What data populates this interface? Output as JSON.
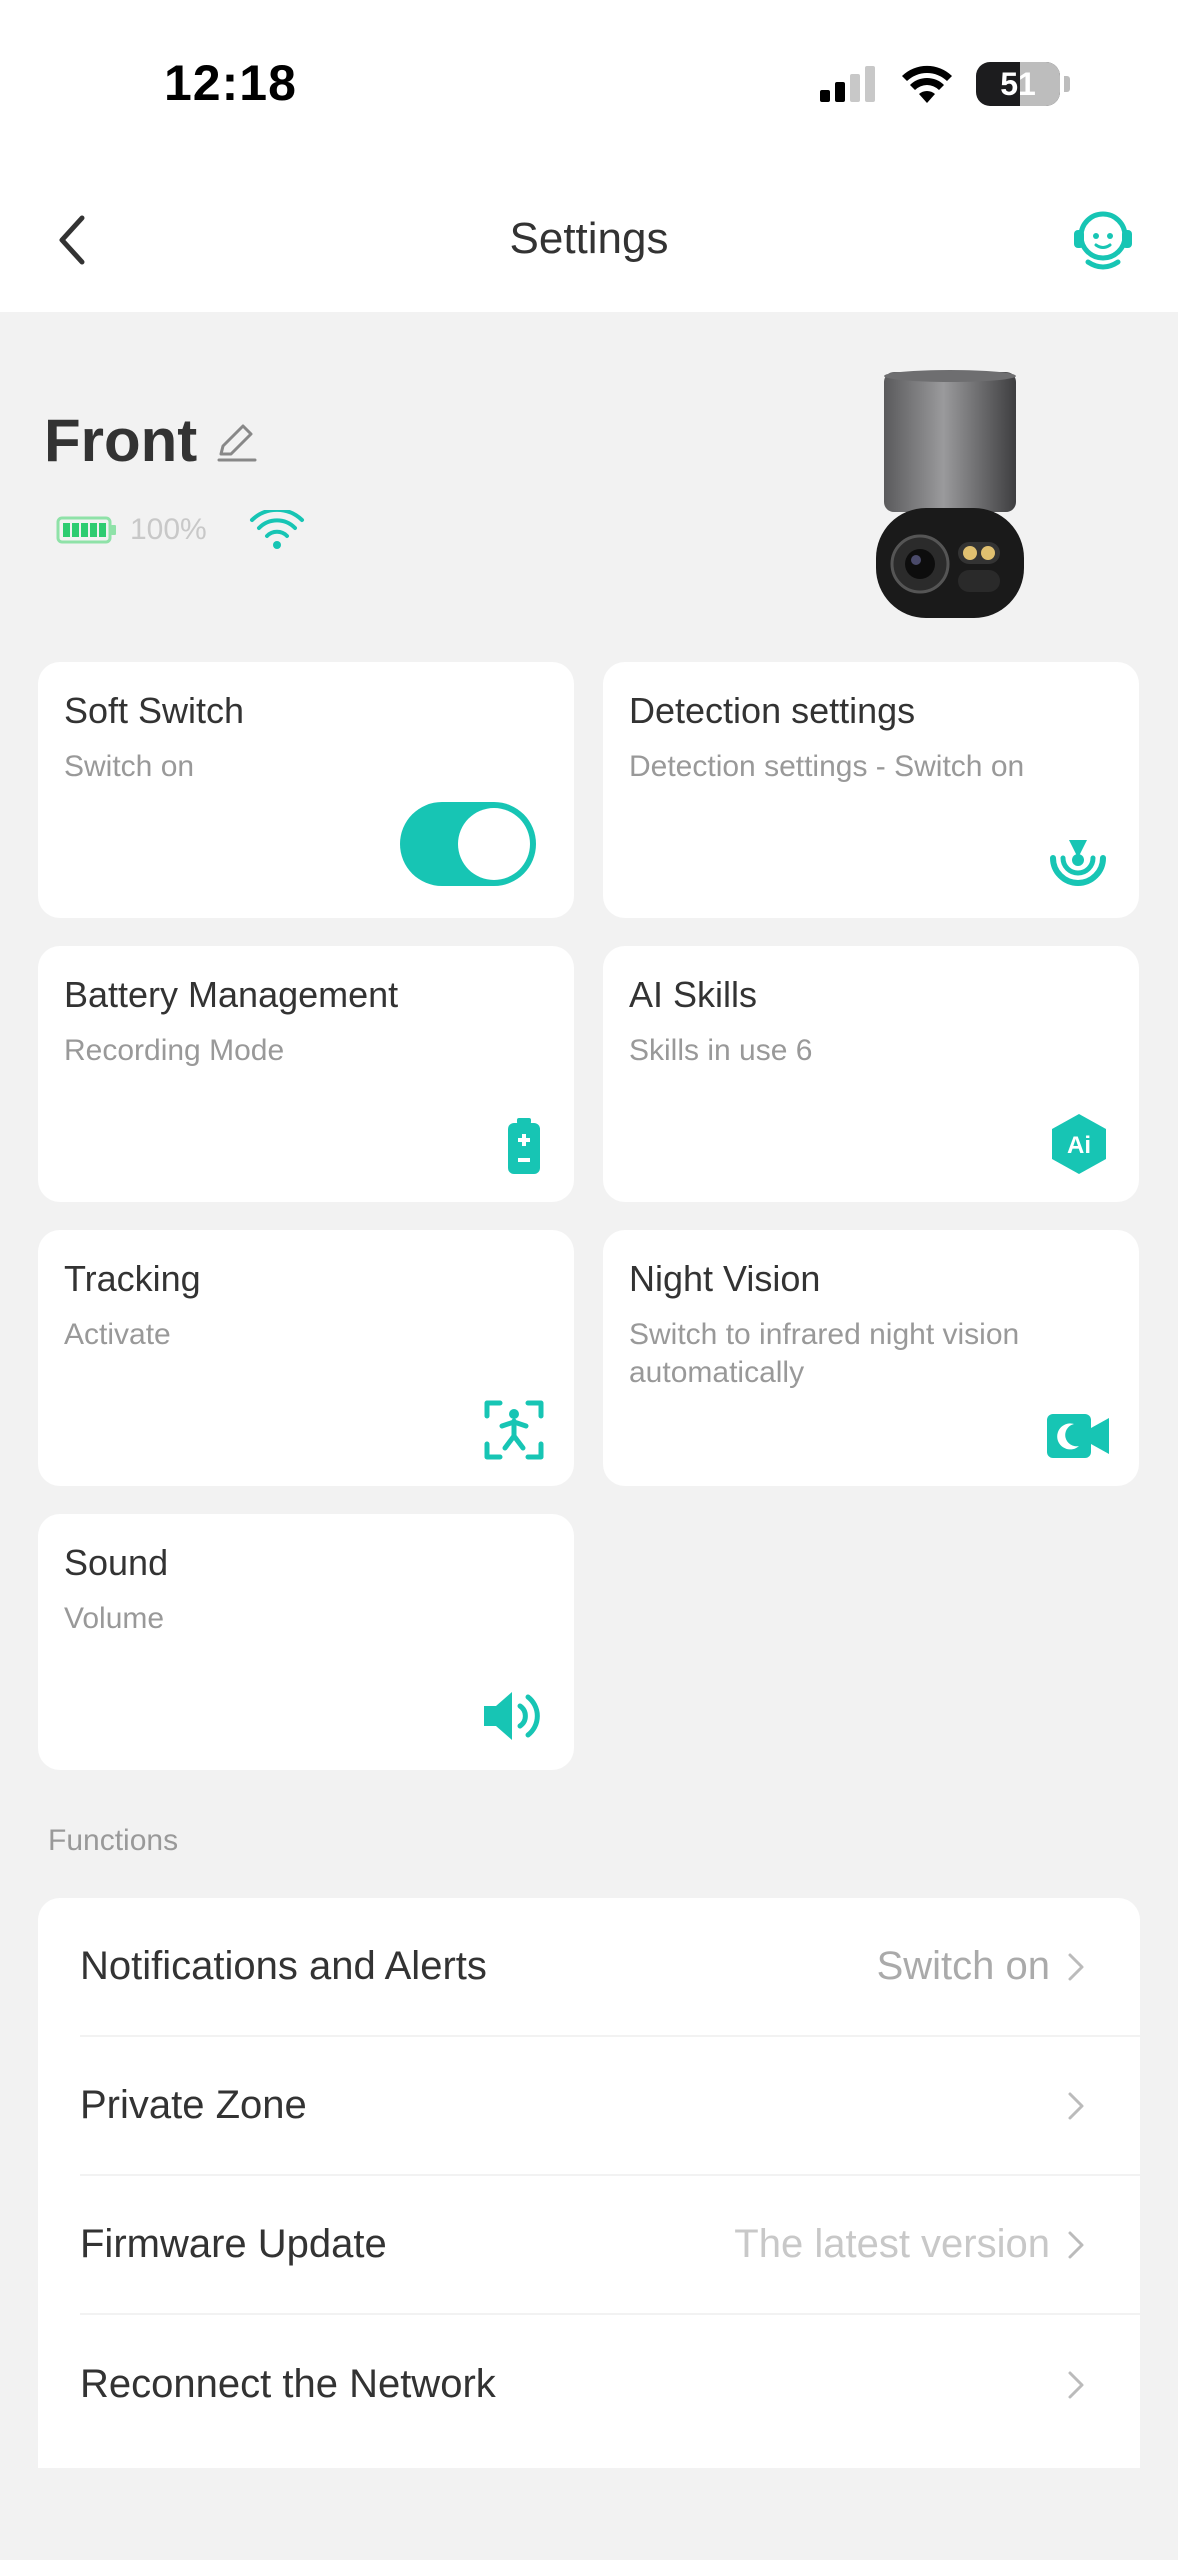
{
  "status_bar": {
    "time": "12:18",
    "battery": "51"
  },
  "nav": {
    "title": "Settings"
  },
  "device": {
    "name": "Front",
    "battery_percent": "100%"
  },
  "cards": [
    {
      "title": "Soft Switch",
      "subtitle": "Switch on",
      "toggle_on": true
    },
    {
      "title": "Detection settings",
      "subtitle": "Detection settings - Switch on",
      "icon": "detection-icon"
    },
    {
      "title": "Battery Management",
      "subtitle": "Recording Mode",
      "icon": "battery-icon"
    },
    {
      "title": "AI Skills",
      "subtitle": "Skills in use 6",
      "icon": "ai-icon",
      "icon_text": "Ai"
    },
    {
      "title": "Tracking",
      "subtitle": "Activate",
      "icon": "tracking-icon"
    },
    {
      "title": "Night Vision",
      "subtitle": "Switch to infrared night vision automatically",
      "icon": "night-vision-icon"
    },
    {
      "title": "Sound",
      "subtitle": "Volume",
      "icon": "speaker-icon"
    }
  ],
  "functions": {
    "section_label": "Functions",
    "items": [
      {
        "label": "Notifications and Alerts",
        "value": "Switch on"
      },
      {
        "label": "Private Zone",
        "value": ""
      },
      {
        "label": "Firmware Update",
        "value": "The latest version"
      },
      {
        "label": "Reconnect the Network",
        "value": ""
      }
    ]
  },
  "colors": {
    "accent": "#17c5b4",
    "background": "#f2f2f2",
    "card": "#ffffff",
    "battery_green": "#2ecc71"
  }
}
